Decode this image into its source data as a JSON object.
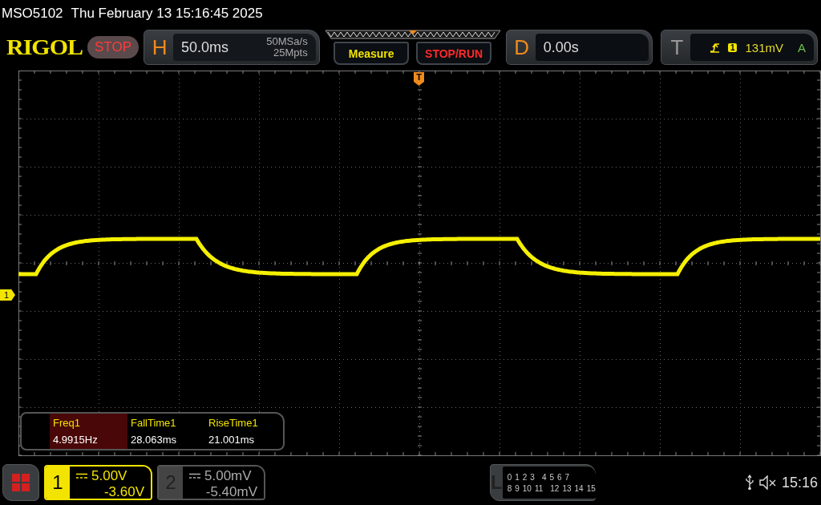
{
  "title_bar": {
    "model": "MSO5102",
    "datetime": "Thu February 13 15:16:45 2025"
  },
  "toolbar": {
    "logo": "RIGOL",
    "run_state": "STOP",
    "horizontal": {
      "label": "H",
      "timebase": "50.0ms",
      "sample_rate": "50MSa/s",
      "memory_depth": "25Mpts"
    },
    "buttons": [
      "Measure",
      "STOP/RUN"
    ],
    "delay": {
      "label": "D",
      "value": "0.00s"
    },
    "trigger": {
      "label": "T",
      "source": "1",
      "level": "131mV",
      "mode": "A"
    }
  },
  "screen": {
    "trigger_marker": "T",
    "channel_marker": "1"
  },
  "measurements": [
    {
      "name": "Freq1",
      "value": "4.9915Hz",
      "selected": true
    },
    {
      "name": "FallTime1",
      "value": "28.063ms",
      "selected": false
    },
    {
      "name": "RiseTime1",
      "value": "21.001ms",
      "selected": false
    }
  ],
  "channels": [
    {
      "number": "1",
      "scale": "5.00V",
      "offset": "-3.60V",
      "on": true
    },
    {
      "number": "2",
      "scale": "5.00mV",
      "offset": "-5.40mV",
      "on": false
    }
  ],
  "logic": {
    "label": "L",
    "row_1": [
      "0",
      "1",
      "2",
      "3",
      "4",
      "5",
      "6",
      "7"
    ],
    "row_2": [
      "8",
      "9",
      "10",
      "11",
      "12",
      "13",
      "14",
      "15"
    ]
  },
  "status": {
    "time": "15:16"
  }
}
